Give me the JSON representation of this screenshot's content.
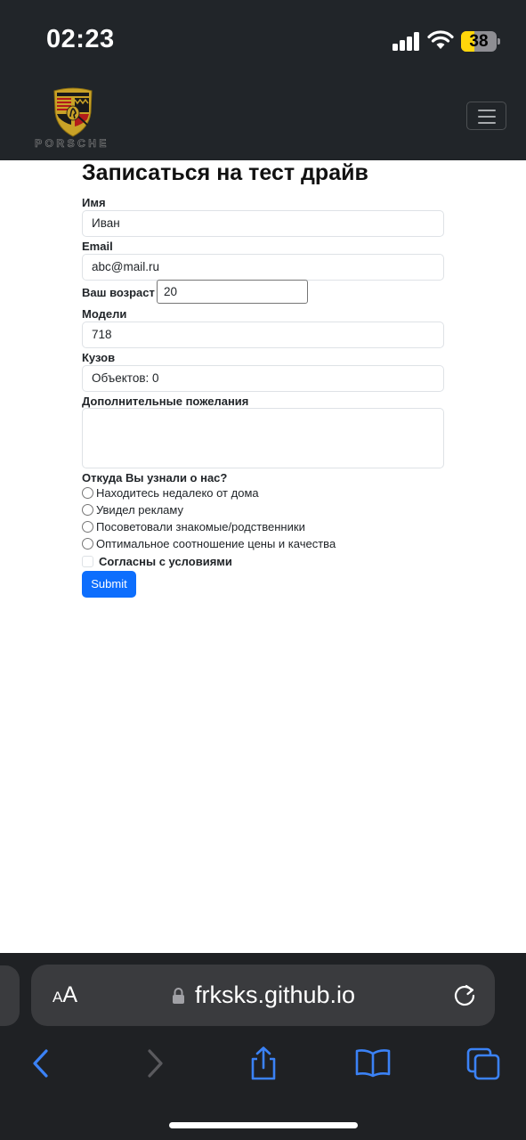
{
  "status_bar": {
    "time": "02:23",
    "battery_percent": 38,
    "battery_label": "38",
    "icons": [
      "signal-icon",
      "wifi-icon",
      "battery-icon"
    ]
  },
  "navbar": {
    "brand_text": "PORSCHE",
    "menu_icon": "hamburger-icon"
  },
  "form": {
    "title": "Записаться на тест драйв",
    "name_label": "Имя",
    "name_value": "Иван",
    "email_label": "Email",
    "email_value": "abc@mail.ru",
    "age_label": "Ваш возраст",
    "age_value": "20",
    "models_label": "Модели",
    "models_value": "718",
    "body_label": "Кузов",
    "body_value": "Объектов: 0",
    "wishes_label": "Дополнительные пожелания",
    "wishes_value": "",
    "source_label": "Откуда Вы узнали о нас?",
    "source_options": [
      "Находитесь недалеко от дома",
      "Увидел рекламу",
      "Посоветовали знакомые/родственники",
      "Оптимальное соотношение цены и качества"
    ],
    "agree_label": "Согласны с условиями",
    "submit_label": "Submit"
  },
  "safari": {
    "text_size_label_small": "A",
    "text_size_label_large": "A",
    "domain": "frksks.github.io",
    "toolbar_icons": [
      "back-icon",
      "forward-icon",
      "share-icon",
      "bookmarks-icon",
      "tabs-icon"
    ]
  },
  "colors": {
    "navbar_bg": "#212529",
    "primary_button": "#0d6efd",
    "safari_bar": "#1f2124",
    "safari_accent": "#3b82f6",
    "battery_fill": "#ffd60a"
  }
}
